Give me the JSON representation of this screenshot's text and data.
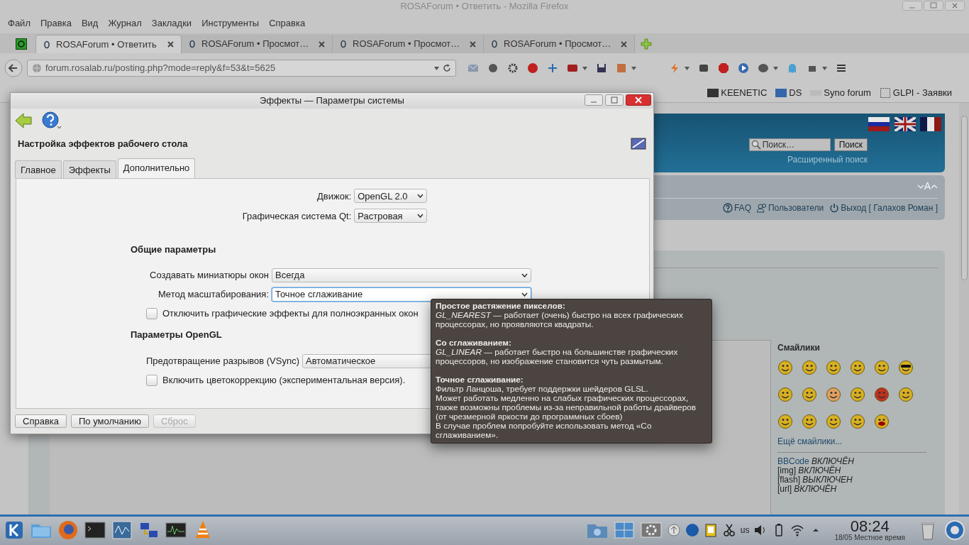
{
  "browser": {
    "title": "ROSAForum • Ответить - Mozilla Firefox",
    "menu": [
      "Файл",
      "Правка",
      "Вид",
      "Журнал",
      "Закладки",
      "Инструменты",
      "Справка"
    ],
    "tabs": [
      {
        "label": "ROSAForum • Ответить",
        "selected": true
      },
      {
        "label": "ROSAForum • Просмот…",
        "selected": false
      },
      {
        "label": "ROSAForum • Просмот…",
        "selected": false
      },
      {
        "label": "ROSAForum • Просмот…",
        "selected": false
      }
    ],
    "address": "forum.rosalab.ru/posting.php?mode=reply&f=53&t=5625",
    "bookmarks": [
      "KEENETIC",
      "DS",
      "Syno forum",
      "GLPI - Заявки"
    ]
  },
  "page": {
    "search": {
      "placeholder": "Поиск…",
      "button": "Поиск"
    },
    "advanced_search": "Расширенный поиск",
    "font_size": "A",
    "nav_links": [
      {
        "kind": "faq",
        "label": "FAQ"
      },
      {
        "kind": "users",
        "label": "Пользователи"
      },
      {
        "kind": "logout",
        "label": "Выход [ Галахов Роман ]"
      }
    ],
    "smilies_title": "Смайлики",
    "more_smilies": "Ещё смайлики...",
    "bbcode": [
      {
        "kind": "link",
        "label": "BBCode",
        "value": "ВКЛЮЧЁН"
      },
      {
        "kind": "plain",
        "label": "[img]",
        "value": "ВКЛЮЧЁН"
      },
      {
        "kind": "plain",
        "label": "[flash]",
        "value": "ВЫКЛЮЧЕН"
      },
      {
        "kind": "plain",
        "label": "[url]",
        "value": "ВКЛЮЧЁН"
      }
    ]
  },
  "dialog": {
    "title": "Эффекты — Параметры системы",
    "heading": "Настройка эффектов рабочего стола",
    "tabs": [
      {
        "label": "Главное",
        "selected": false
      },
      {
        "label": "Эффекты",
        "selected": false
      },
      {
        "label": "Дополнительно",
        "selected": true
      }
    ],
    "top_fields": [
      {
        "label": "Движок:",
        "value": "OpenGL 2.0"
      },
      {
        "label": "Графическая система Qt:",
        "value": "Растровая"
      }
    ],
    "sections": [
      {
        "title": "Общие параметры",
        "items": [
          {
            "kind": "select",
            "label": "Создавать миниатюры окон",
            "value": "Всегда",
            "focused": false
          },
          {
            "kind": "select",
            "label": "Метод масштабирования:",
            "value": "Точное сглаживание",
            "focused": true
          },
          {
            "kind": "checkbox",
            "label": "Отключить графические эффекты для полноэкранных окон",
            "checked": false
          }
        ]
      },
      {
        "title": "Параметры OpenGL",
        "items": [
          {
            "kind": "select",
            "label": "Предотвращение разрывов (VSync)",
            "value": "Автоматическое",
            "focused": false
          },
          {
            "kind": "checkbox",
            "label": "Включить цветокоррекцию (экспериментальная версия).",
            "checked": false
          }
        ]
      }
    ],
    "buttons": [
      {
        "label": "Справка",
        "disabled": false
      },
      {
        "label": "По умолчанию",
        "disabled": false
      },
      {
        "label": "Сброс",
        "disabled": true
      }
    ]
  },
  "tooltip": {
    "sections": [
      {
        "title": "Простое растяжение пикселов:",
        "paragraphs": [
          "*GL_NEAREST* — работает (очень) быстро на всех графических процессорах, но проявляются квадраты."
        ]
      },
      {
        "title": "Со сглаживанием:",
        "paragraphs": [
          "*GL_LINEAR* — работает быстро на большинстве графических процессоров, но изображение становится чуть размытым."
        ]
      },
      {
        "title": "Точное сглаживание:",
        "paragraphs": [
          "Фильтр Ланцоша, требует поддержки шейдеров GLSL.",
          "Может работать медленно на слабых графических процессорах, также возможны проблемы из-за неправильной работы драйверов (от чрезмерной яркости до программных сбоев)",
          "В случае проблем попробуйте использовать метод «Со сглаживанием»."
        ]
      }
    ]
  },
  "taskbar": {
    "layout": "us",
    "clock": "08:24",
    "date": "18/05 Местное время"
  }
}
